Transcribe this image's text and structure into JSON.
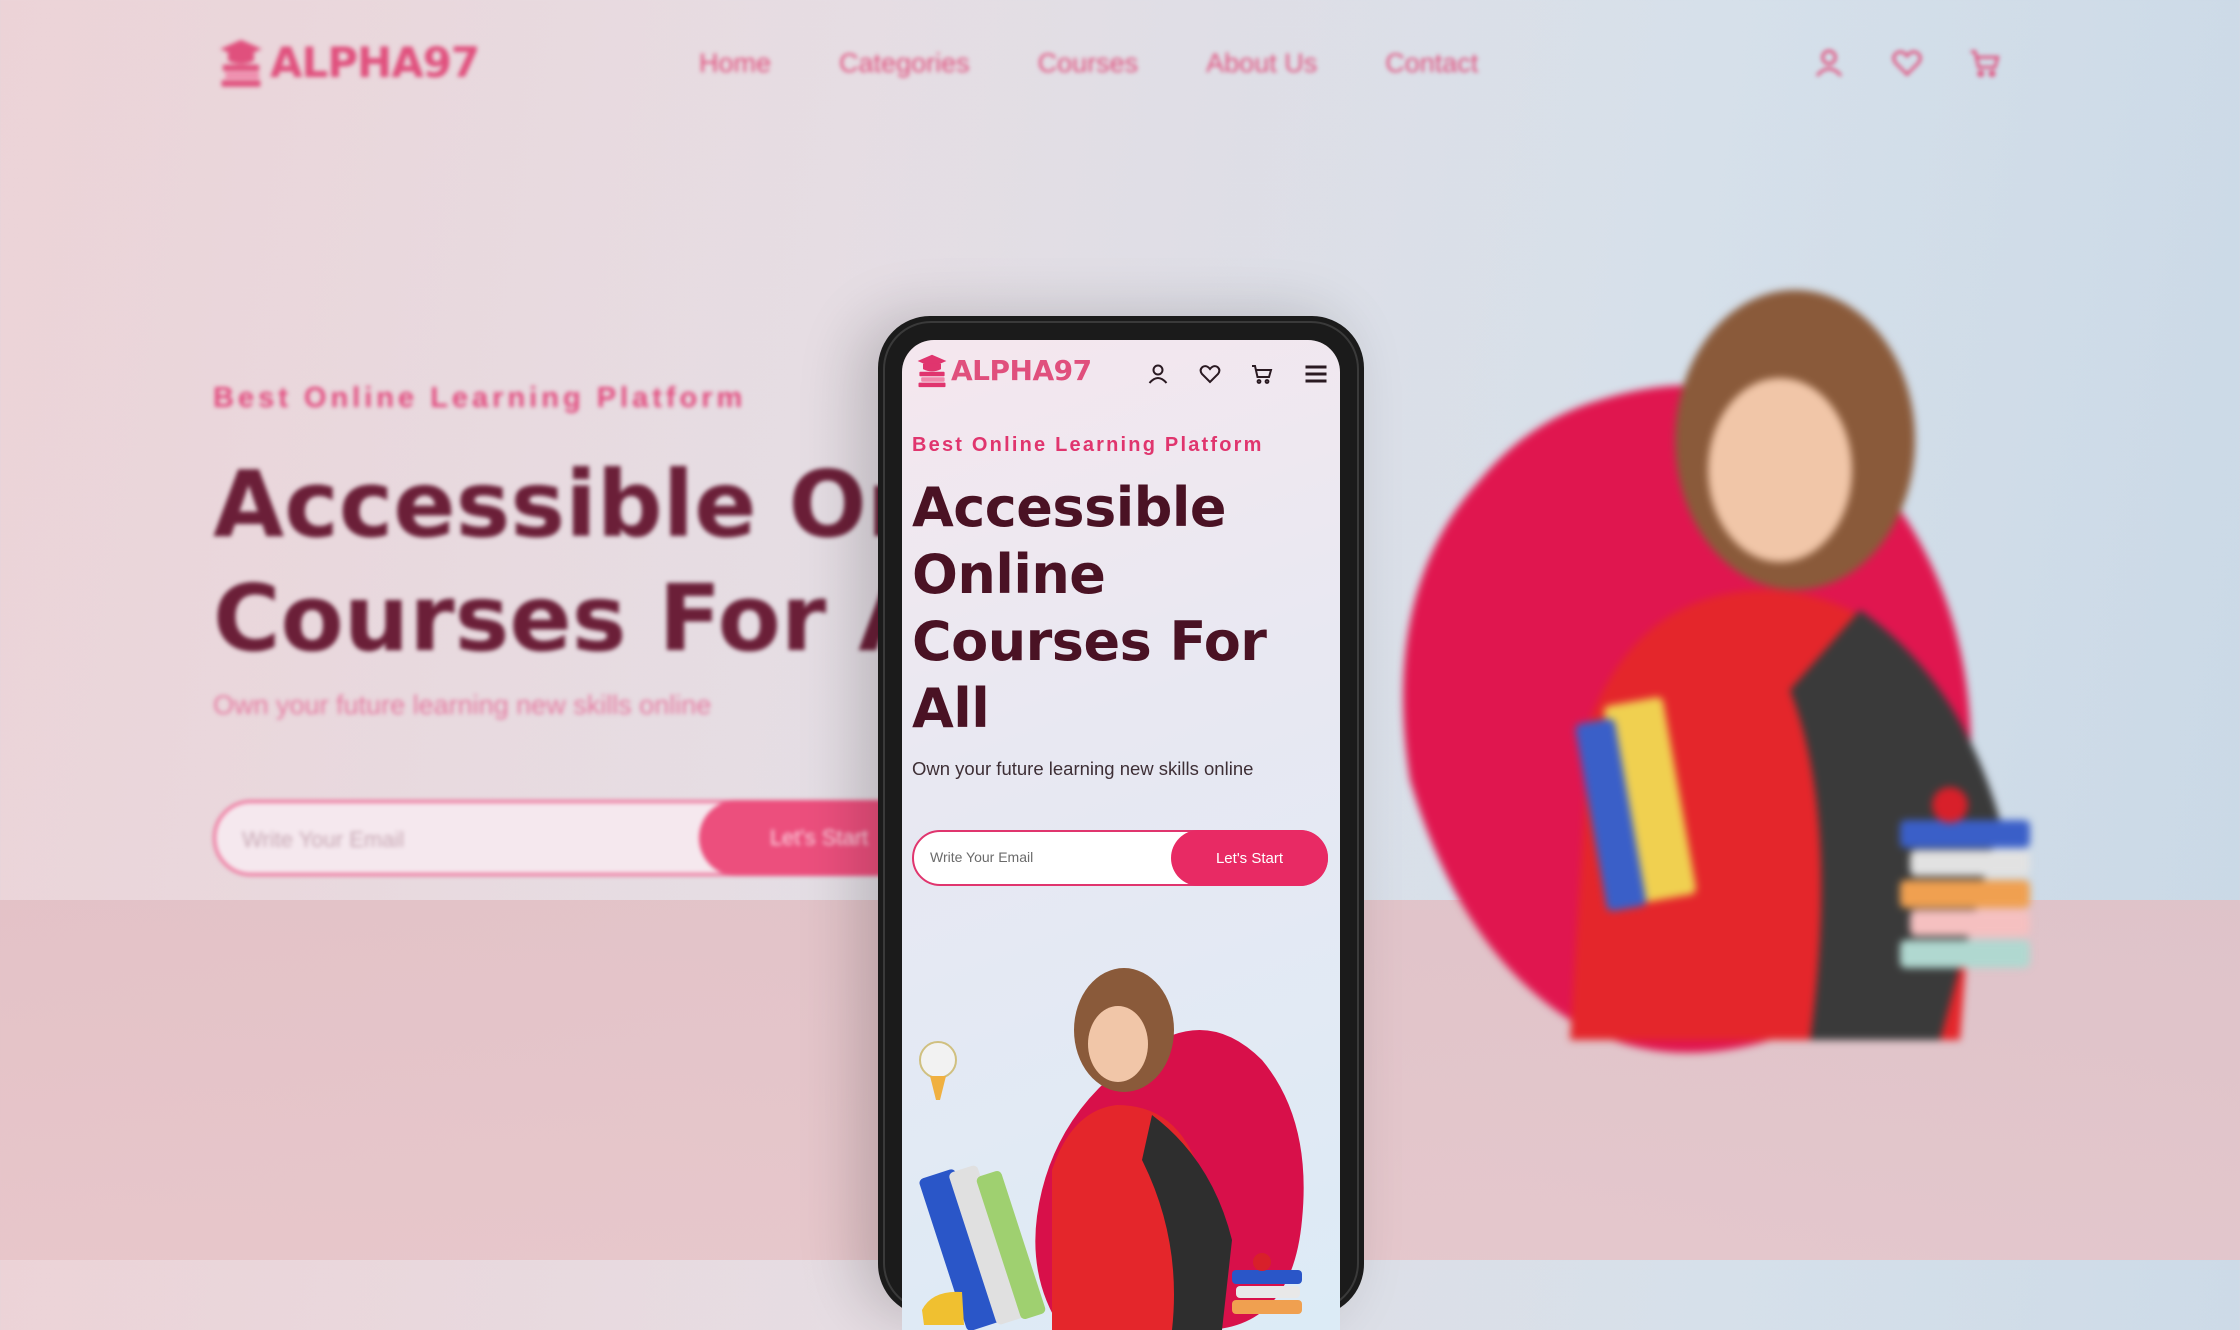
{
  "brand": {
    "name": "ALPHA97",
    "accent": "#e0356e",
    "headline_color": "#4a1224"
  },
  "nav": {
    "items": [
      {
        "label": "Home"
      },
      {
        "label": "Categories"
      },
      {
        "label": "Courses"
      },
      {
        "label": "About Us"
      },
      {
        "label": "Contact"
      }
    ]
  },
  "header_icons": [
    "user-icon",
    "heart-icon",
    "cart-icon"
  ],
  "mobile_header_icons": [
    "user-icon",
    "heart-icon",
    "cart-icon",
    "menu-icon"
  ],
  "hero": {
    "tagline": "Best Online Learning Platform",
    "headline_line1": "Accessible Online",
    "headline_line2": "Courses For All",
    "headline_mobile": "Accessible Online Courses For All",
    "subtitle": "Own your future learning new skills online",
    "email_placeholder": "Write Your Email",
    "cta_label": "Let's Start"
  }
}
